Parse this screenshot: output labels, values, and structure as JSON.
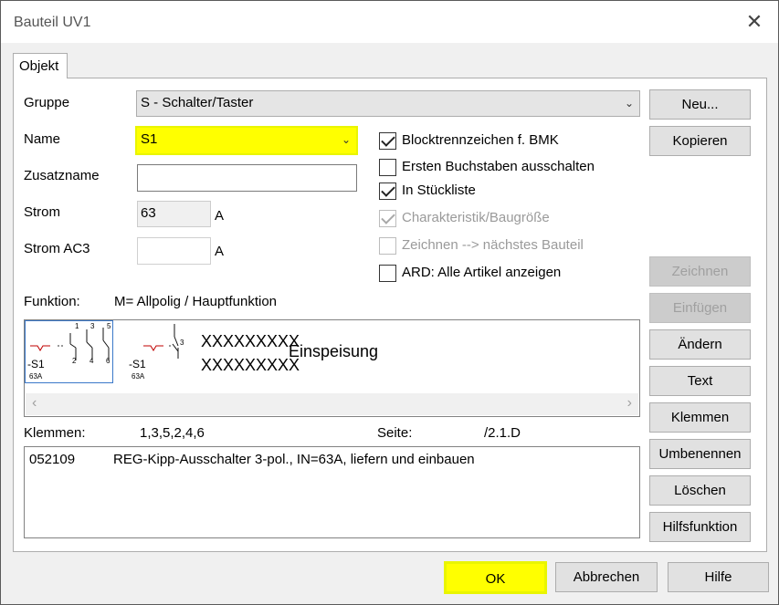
{
  "window": {
    "title": "Bauteil UV1",
    "close_glyph": "✕"
  },
  "tab": {
    "label": "Objekt"
  },
  "form": {
    "gruppe_label": "Gruppe",
    "gruppe_value": "S - Schalter/Taster",
    "name_label": "Name",
    "name_value": "S1",
    "zusatzname_label": "Zusatzname",
    "zusatzname_value": "",
    "strom_label": "Strom",
    "strom_value": "63",
    "strom_unit": "A",
    "strom_ac3_label": "Strom AC3",
    "strom_ac3_value": "",
    "strom_ac3_unit": "A"
  },
  "checkboxes": [
    {
      "label": "Blocktrennzeichen f. BMK",
      "checked": true,
      "enabled": true
    },
    {
      "label": "Ersten Buchstaben ausschalten",
      "checked": false,
      "enabled": true
    },
    {
      "label": "In Stückliste",
      "checked": true,
      "enabled": true
    },
    {
      "label": "Charakteristik/Baugröße",
      "checked": true,
      "enabled": false
    },
    {
      "label": "Zeichnen --> nächstes Bauteil",
      "checked": false,
      "enabled": false
    },
    {
      "label": "ARD: Alle Artikel anzeigen",
      "checked": false,
      "enabled": true
    }
  ],
  "funktion": {
    "label": "Funktion:",
    "value": "M= Allpolig / Hauptfunktion"
  },
  "preview": {
    "symbol1_bmk": "-S1",
    "symbol1_rating": "63A",
    "symbol1_pins_top": [
      "1",
      "3",
      "5"
    ],
    "symbol1_pins_bottom": [
      "2",
      "4",
      "6"
    ],
    "symbol2_bmk": "-S1",
    "symbol2_rating": "63A",
    "symbol2_pin": "3",
    "text_line1": "XXXXXXXXX",
    "text_line2": "XXXXXXXXX",
    "text_label": "Einspeisung"
  },
  "klemmen": {
    "label": "Klemmen:",
    "value": "1,3,5,2,4,6"
  },
  "seite": {
    "label": "Seite:",
    "value": "/2.1.D"
  },
  "article": {
    "number": "052109",
    "description": "REG-Kipp-Ausschalter 3-pol., IN=63A, liefern und einbauen"
  },
  "side_buttons": {
    "neu": "Neu...",
    "kopieren": "Kopieren",
    "zeichnen": "Zeichnen",
    "einfuegen": "Einfügen",
    "aendern": "Ändern",
    "text": "Text",
    "klemmen": "Klemmen",
    "umbenennen": "Umbenennen",
    "loeschen": "Löschen",
    "hilfsfunktion": "Hilfsfunktion"
  },
  "footer": {
    "ok": "OK",
    "abbrechen": "Abbrechen",
    "hilfe": "Hilfe"
  },
  "colors": {
    "highlight": "#ffff00",
    "highlight_border": "#e9f500"
  }
}
